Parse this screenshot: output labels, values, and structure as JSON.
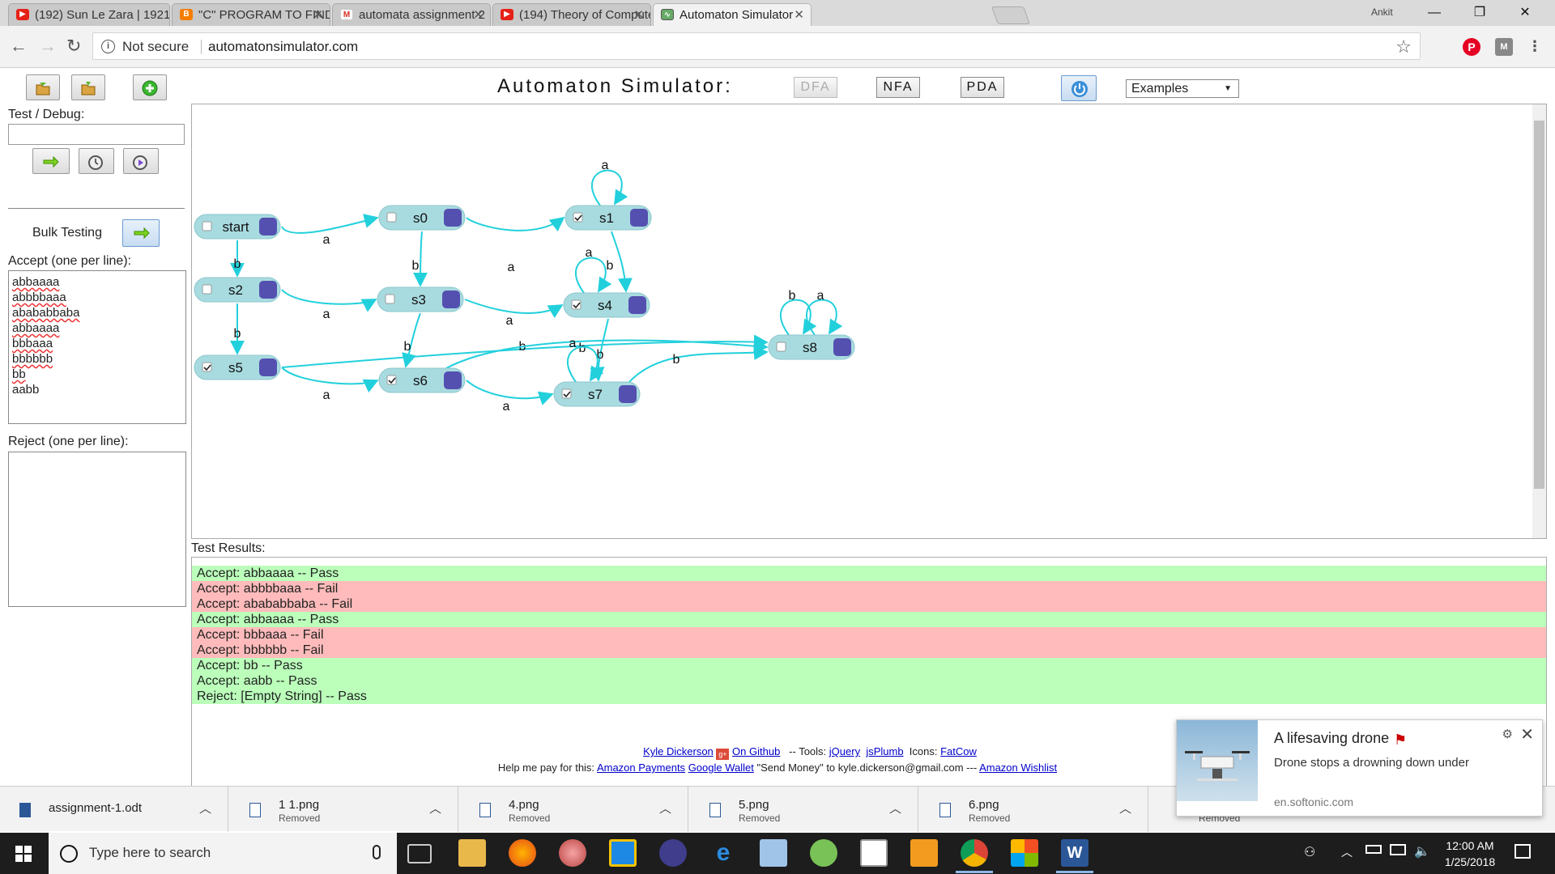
{
  "browser": {
    "tabs": [
      {
        "label": "(192) Sun Le Zara | 1921",
        "icon": "youtube-icon"
      },
      {
        "label": "\"C\" PROGRAM TO FIND",
        "icon": "blogger-icon"
      },
      {
        "label": "automata assignment 2",
        "icon": "gmail-icon"
      },
      {
        "label": "(194) Theory of Compute",
        "icon": "youtube-icon"
      },
      {
        "label": "Automaton Simulator",
        "icon": "automaton-icon"
      }
    ],
    "user": "Ankit",
    "security_label": "Not secure",
    "url": "automatonsimulator.com"
  },
  "sidebar": {
    "test_debug_label": "Test / Debug:",
    "test_input_value": "",
    "bulk_testing_label": "Bulk Testing",
    "accept_label": "Accept (one per line):",
    "accept_lines": [
      "abbaaaa",
      "abbbbaaa",
      "abababbaba",
      "abbaaaa",
      "bbbaaa",
      "bbbbbb",
      "bb",
      "aabb"
    ],
    "reject_label": "Reject (one per line):",
    "reject_lines": []
  },
  "header": {
    "title": "Automaton  Simulator:",
    "modes": [
      "DFA",
      "NFA",
      "PDA"
    ],
    "examples_label": "Examples"
  },
  "automaton": {
    "states": [
      {
        "id": "start",
        "accepting": false
      },
      {
        "id": "s0",
        "accepting": false
      },
      {
        "id": "s1",
        "accepting": true
      },
      {
        "id": "s2",
        "accepting": false
      },
      {
        "id": "s3",
        "accepting": false
      },
      {
        "id": "s4",
        "accepting": true
      },
      {
        "id": "s5",
        "accepting": true
      },
      {
        "id": "s6",
        "accepting": true
      },
      {
        "id": "s7",
        "accepting": true
      },
      {
        "id": "s8",
        "accepting": false
      }
    ],
    "transitions": [
      {
        "from": "start",
        "to": "s0",
        "symbol": "a"
      },
      {
        "from": "start",
        "to": "s2",
        "symbol": "b"
      },
      {
        "from": "s0",
        "to": "s1",
        "symbol": "a"
      },
      {
        "from": "s0",
        "to": "s3",
        "symbol": "b"
      },
      {
        "from": "s1",
        "to": "s1",
        "symbol": "a"
      },
      {
        "from": "s1",
        "to": "s4",
        "symbol": "b"
      },
      {
        "from": "s2",
        "to": "s3",
        "symbol": "a"
      },
      {
        "from": "s2",
        "to": "s5",
        "symbol": "b"
      },
      {
        "from": "s3",
        "to": "s4",
        "symbol": "a"
      },
      {
        "from": "s3",
        "to": "s6",
        "symbol": "b"
      },
      {
        "from": "s4",
        "to": "s4",
        "symbol": "a"
      },
      {
        "from": "s4",
        "to": "s7",
        "symbol": "b"
      },
      {
        "from": "s5",
        "to": "s6",
        "symbol": "a"
      },
      {
        "from": "s5",
        "to": "s8",
        "symbol": "b"
      },
      {
        "from": "s6",
        "to": "s7",
        "symbol": "a"
      },
      {
        "from": "s6",
        "to": "s8",
        "symbol": "b"
      },
      {
        "from": "s7",
        "to": "s7",
        "symbol": "a"
      },
      {
        "from": "s7",
        "to": "s8",
        "symbol": "b"
      },
      {
        "from": "s8",
        "to": "s8",
        "symbol": "b"
      },
      {
        "from": "s8",
        "to": "s8",
        "symbol": "a"
      }
    ]
  },
  "results": {
    "label": "Test Results:",
    "rows": [
      {
        "text": "Accept: abbaaaa -- Pass",
        "status": "pass"
      },
      {
        "text": "Accept: abbbbaaa -- Fail",
        "status": "fail"
      },
      {
        "text": "Accept: abababbaba -- Fail",
        "status": "fail"
      },
      {
        "text": "Accept: abbaaaa -- Pass",
        "status": "pass"
      },
      {
        "text": "Accept: bbbaaa -- Fail",
        "status": "fail"
      },
      {
        "text": "Accept: bbbbbb -- Fail",
        "status": "fail"
      },
      {
        "text": "Accept: bb -- Pass",
        "status": "pass"
      },
      {
        "text": "Accept: aabb -- Pass",
        "status": "pass"
      },
      {
        "text": "Reject: [Empty String] -- Pass",
        "status": "pass"
      }
    ]
  },
  "footer": {
    "author": "Kyle Dickerson",
    "github": "On Github",
    "tools_label": "-- Tools:",
    "jquery": "jQuery",
    "jsplumb": "jsPlumb",
    "icons_label": "Icons:",
    "fatcow": "FatCow",
    "pay_label": "Help me pay for this:",
    "amazon_payments": "Amazon Payments",
    "google_wallet": "Google Wallet",
    "send_money": "\"Send Money\" to kyle.dickerson@gmail.com ---",
    "wishlist": "Amazon Wishlist"
  },
  "notification": {
    "title": "A lifesaving drone",
    "body": "Drone stops a drowning down under",
    "source": "en.softonic.com"
  },
  "downloads": [
    {
      "name": "assignment-1.odt",
      "status": ""
    },
    {
      "name": "1 1.png",
      "status": "Removed"
    },
    {
      "name": "4.png",
      "status": "Removed"
    },
    {
      "name": "5.png",
      "status": "Removed"
    },
    {
      "name": "6.png",
      "status": "Removed"
    },
    {
      "name": "",
      "status": "Removed"
    }
  ],
  "taskbar": {
    "search_placeholder": "Type here to search",
    "time": "12:00 AM",
    "date": "1/25/2018"
  },
  "colors": {
    "state_fill": "#a8dbe0",
    "state_handle": "#5450b0",
    "edge": "#22d0dc",
    "pass": "#bbffbb",
    "fail": "#ffbbbb"
  }
}
